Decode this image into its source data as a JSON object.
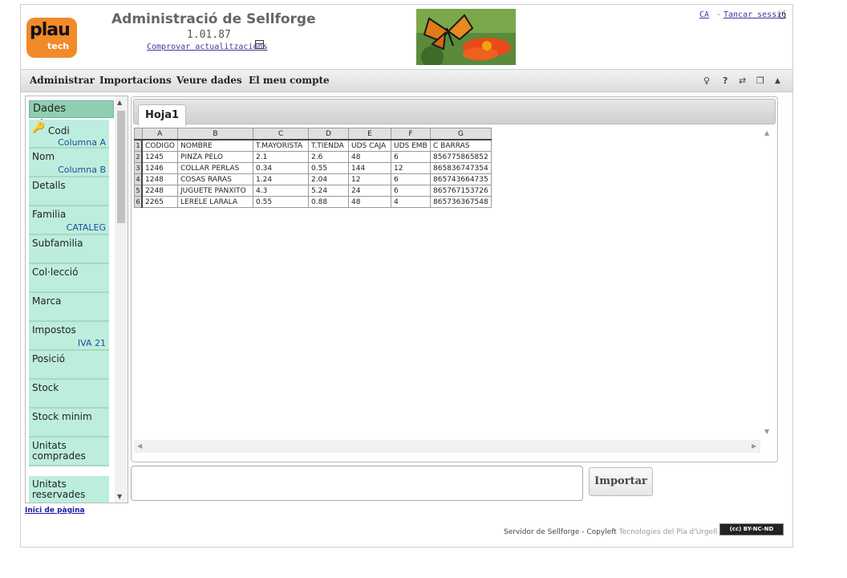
{
  "header": {
    "logo_top": "plau",
    "logo_bottom": "tech",
    "title": "Administració de Sellforge",
    "version": "1.01.87",
    "update_link": "Comprovar actualitzacions",
    "lang": "CA",
    "separator": "-",
    "logout": "Tancar sessió"
  },
  "menu": {
    "items": [
      "Administrar",
      "Importacions",
      "Veure dades",
      "El meu compte"
    ],
    "tools": [
      "lightbulb-icon",
      "help-icon",
      "swap-icon",
      "window-icon",
      "collapse-up-icon"
    ],
    "help_label": "?"
  },
  "sidebar": {
    "header": "Dades bàsiques",
    "items": [
      {
        "label": "Codi",
        "value": "Columna A"
      },
      {
        "label": "Nom",
        "value": "Columna B"
      },
      {
        "label": "Detalls",
        "value": ""
      },
      {
        "label": "Familia",
        "value": "CATALEG"
      },
      {
        "label": "Subfamilia",
        "value": ""
      },
      {
        "label": "Col·lecció",
        "value": ""
      },
      {
        "label": "Marca",
        "value": ""
      },
      {
        "label": "Impostos",
        "value": "IVA 21"
      },
      {
        "label": "Posició",
        "value": ""
      },
      {
        "label": "Stock",
        "value": ""
      },
      {
        "label": "Stock minim",
        "value": ""
      },
      {
        "label": "Unitats comprades",
        "value": ""
      },
      {
        "label": "Unitats reservades",
        "value": ""
      }
    ]
  },
  "top_link": "Inici de pàgina",
  "sheet": {
    "tab": "Hoja1",
    "columns": [
      "A",
      "B",
      "C",
      "D",
      "E",
      "F",
      "G"
    ],
    "rows": [
      [
        "CODIGO",
        "NOMBRE",
        "T.MAYORISTA",
        "T.TIENDA",
        "UDS CAJA",
        "UDS EMB",
        "C BARRAS"
      ],
      [
        "1245",
        "PINZA PELO",
        "2.1",
        "2.6",
        "48",
        "6",
        "856775865852"
      ],
      [
        "1246",
        "COLLAR PERLAS",
        "0.34",
        "0.55",
        "144",
        "12",
        "865836747354"
      ],
      [
        "1248",
        "COSAS RARAS",
        "1.24",
        "2.04",
        "12",
        "6",
        "865743664735"
      ],
      [
        "2248",
        "JUGUETE PANXITO",
        "4.3",
        "5.24",
        "24",
        "6",
        "865767153726"
      ],
      [
        "2265",
        "LERELE LARALA",
        "0.55",
        "0.88",
        "48",
        "4",
        "865736367548"
      ]
    ]
  },
  "import_button": "Importar",
  "footer": {
    "text": "Servidor de Sellforge - Copyleft",
    "company": "Tecnologies del Pla d'Urgell S.L.",
    "license": "BY-NC-ND"
  }
}
